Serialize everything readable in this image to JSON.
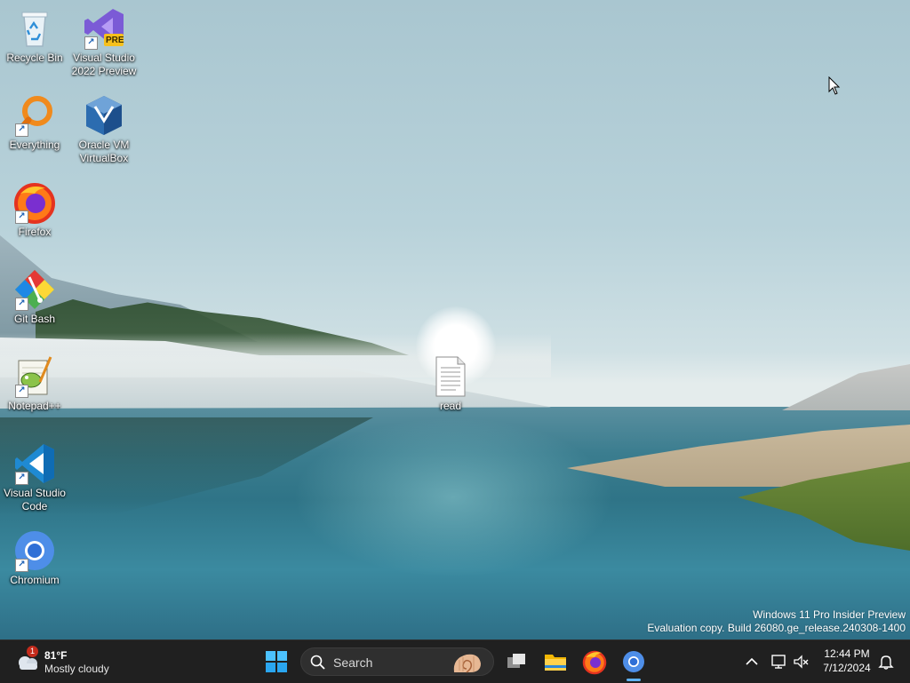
{
  "desktop_icons": [
    {
      "label": "Recycle Bin",
      "icon": "recycle-bin-icon"
    },
    {
      "label": "Visual Studio\n2022 Preview",
      "icon": "visual-studio-preview-icon",
      "badge": "PRE"
    },
    {
      "label": "Everything",
      "icon": "everything-search-icon"
    },
    {
      "label": "Oracle VM\nVirtualBox",
      "icon": "virtualbox-icon"
    },
    {
      "label": "Firefox",
      "icon": "firefox-icon"
    },
    {
      "label": "Git Bash",
      "icon": "git-bash-icon"
    },
    {
      "label": "Notepad++",
      "icon": "notepad-plus-plus-icon"
    },
    {
      "label": "Visual Studio\nCode",
      "icon": "vscode-icon"
    },
    {
      "label": "Chromium",
      "icon": "chromium-icon"
    },
    {
      "label": "read",
      "icon": "text-file-icon"
    }
  ],
  "watermark": {
    "line1": "Windows 11 Pro Insider Preview",
    "line2": "Evaluation copy. Build 26080.ge_release.240308-1400"
  },
  "taskbar": {
    "weather": {
      "temp": "81°F",
      "condition": "Mostly cloudy",
      "badge": "1"
    },
    "search": {
      "placeholder": "Search"
    },
    "apps": [
      {
        "name": "Task View",
        "icon": "task-view-icon"
      },
      {
        "name": "File Explorer",
        "icon": "file-explorer-icon"
      },
      {
        "name": "Firefox",
        "icon": "firefox-icon"
      },
      {
        "name": "Chromium",
        "icon": "chromium-icon",
        "active": true
      }
    ],
    "clock": {
      "time": "12:44 PM",
      "date": "7/12/2024"
    }
  },
  "colors": {
    "taskbar_bg": "#202020",
    "accent": "#5fb2f2",
    "badge_red": "#c42b1c"
  }
}
